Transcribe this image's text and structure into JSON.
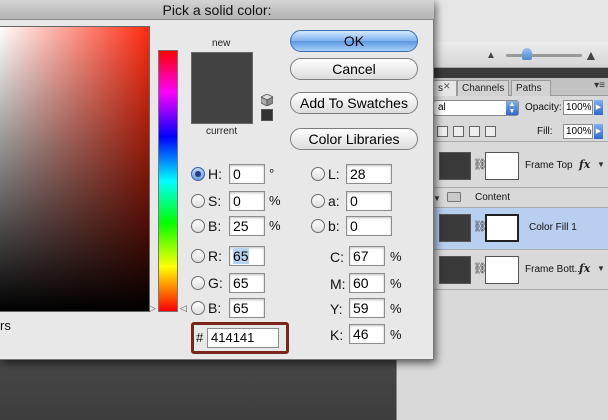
{
  "dialog": {
    "title": "Pick a solid color:",
    "only_web_colors": "rs",
    "new_label": "new",
    "current_label": "current",
    "new_color": "#414141",
    "current_color": "#414141",
    "buttons": {
      "ok": "OK",
      "cancel": "Cancel",
      "add_to_swatches": "Add To Swatches",
      "color_libraries": "Color Libraries"
    },
    "hsb": {
      "h_label": "H:",
      "h_value": "0",
      "h_unit": "°",
      "s_label": "S:",
      "s_value": "0",
      "s_unit": "%",
      "b_label": "B:",
      "b_value": "25",
      "b_unit": "%"
    },
    "rgb": {
      "r_label": "R:",
      "r_value": "65",
      "g_label": "G:",
      "g_value": "65",
      "b_label": "B:",
      "b_value": "65"
    },
    "lab": {
      "l_label": "L:",
      "l_value": "28",
      "a_label": "a:",
      "a_value": "0",
      "b_label": "b:",
      "b_value": "0"
    },
    "cmyk": {
      "c_label": "C:",
      "c_value": "67",
      "m_label": "M:",
      "m_value": "60",
      "y_label": "Y:",
      "y_value": "59",
      "k_label": "K:",
      "k_value": "46",
      "unit": "%"
    },
    "hex": {
      "hash": "#",
      "value": "414141"
    },
    "selected_mode": "H"
  },
  "layers_panel": {
    "tabs": [
      "s",
      "Channels",
      "Paths"
    ],
    "blend_mode": "al",
    "opacity_label": "Opacity:",
    "opacity_value": "100%",
    "fill_label": "Fill:",
    "fill_value": "100%",
    "layers": [
      {
        "name": "Frame Top",
        "has_fx": true,
        "fx": "fx"
      },
      {
        "name": "Content",
        "type": "group"
      },
      {
        "name": "Color Fill 1",
        "selected": true
      },
      {
        "name": "Frame Bott...",
        "has_fx": true,
        "fx": "fx"
      }
    ]
  }
}
